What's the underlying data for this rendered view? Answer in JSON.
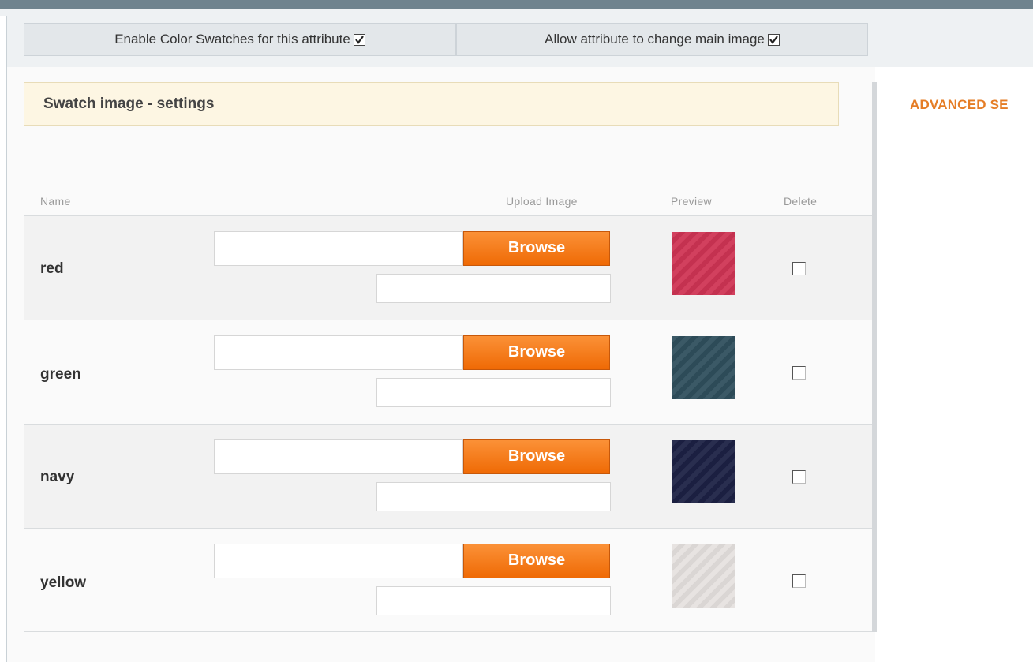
{
  "options": {
    "enable_swatches_label": "Enable Color Swatches for this attribute",
    "enable_swatches_checked": true,
    "change_main_image_label": "Allow attribute to change main image",
    "change_main_image_checked": true
  },
  "section": {
    "title": "Swatch image - settings",
    "advanced_label": "ADVANCED SE"
  },
  "table": {
    "headers": {
      "name": "Name",
      "upload": "Upload Image",
      "preview": "Preview",
      "delete": "Delete"
    },
    "rows": [
      {
        "name": "red",
        "browse_label": "Browse",
        "preview_color": "#cf3454",
        "delete_checked": false
      },
      {
        "name": "green",
        "browse_label": "Browse",
        "preview_color": "#2f4f5d",
        "delete_checked": false
      },
      {
        "name": "navy",
        "browse_label": "Browse",
        "preview_color": "#1c2144",
        "delete_checked": false
      },
      {
        "name": "yellow",
        "browse_label": "Browse",
        "preview_color": "#e6e1df",
        "delete_checked": false
      }
    ]
  }
}
